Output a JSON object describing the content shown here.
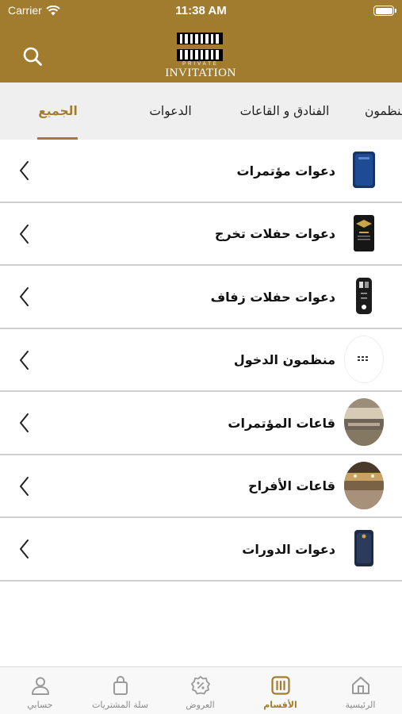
{
  "status_bar": {
    "carrier": "Carrier",
    "time": "11:38 AM"
  },
  "header": {
    "logo_small": "PRIVATE",
    "logo_text": "INVITATION",
    "search_icon": "search-icon"
  },
  "tabs": [
    {
      "label": "الجميع",
      "active": true
    },
    {
      "label": "الدعوات",
      "active": false
    },
    {
      "label": "الفنادق و القاعات",
      "active": false
    },
    {
      "label": "منظمون",
      "active": false
    }
  ],
  "categories": [
    {
      "label": "دعوات مؤتمرات",
      "thumb": "blue-card-thumbnail"
    },
    {
      "label": "دعوات حفلات تخرج",
      "thumb": "graduation-card-thumbnail"
    },
    {
      "label": "دعوات حفلات زفاف",
      "thumb": "wedding-card-thumbnail"
    },
    {
      "label": "منظمون الدخول",
      "thumb": "access-system-thumbnail"
    },
    {
      "label": "قاعات المؤتمرات",
      "thumb": "conference-hall-thumbnail"
    },
    {
      "label": "قاعات الأفراح",
      "thumb": "wedding-hall-thumbnail"
    },
    {
      "label": "دعوات الدورات",
      "thumb": "course-card-thumbnail"
    }
  ],
  "bottom_nav": [
    {
      "label": "الرئيسية",
      "icon": "home-icon",
      "active": false
    },
    {
      "label": "الأقسام",
      "icon": "categories-icon",
      "active": true
    },
    {
      "label": "العروض",
      "icon": "offers-icon",
      "active": false
    },
    {
      "label": "سلة المشتريات",
      "icon": "cart-icon",
      "active": false
    },
    {
      "label": "حسابي",
      "icon": "account-icon",
      "active": false
    }
  ],
  "colors": {
    "brand": "#a27c2e",
    "tab_bg": "#f0efef",
    "divider": "#cfcfcf"
  }
}
